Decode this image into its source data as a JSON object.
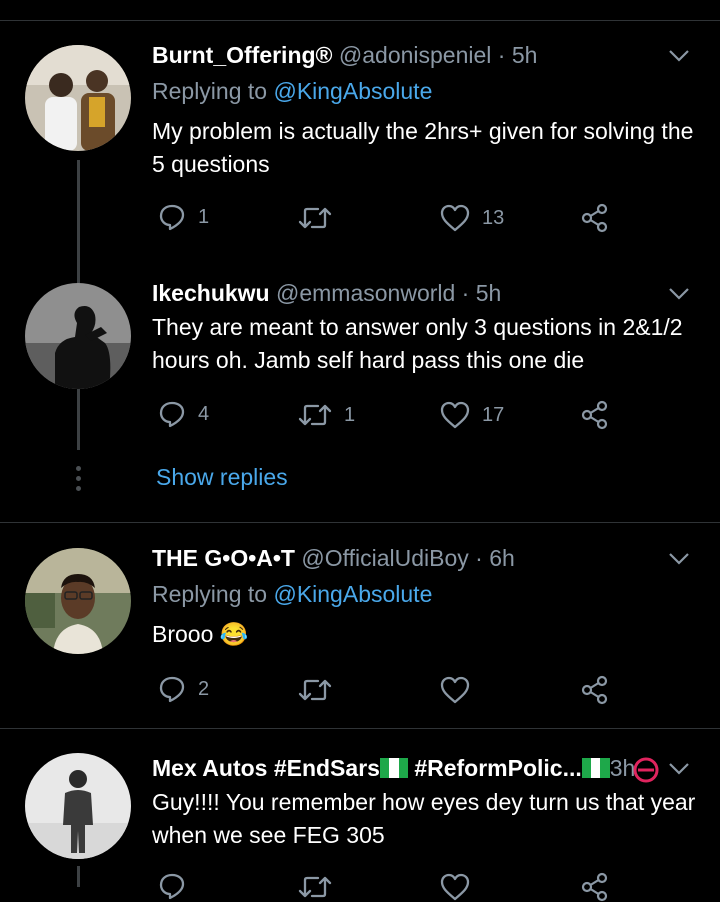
{
  "tweets": [
    {
      "name": "Burnt_Offering®",
      "handle": "@adonispeniel · 5h",
      "replying_prefix": "Replying to ",
      "replying_to": "@KingAbsolute",
      "text": "My problem is actually the 2hrs+ given for solving the 5 questions",
      "replies": "1",
      "retweets": "",
      "likes": "13"
    },
    {
      "name": "Ikechukwu",
      "handle": "@emmasonworld · 5h",
      "text": "They are meant to answer only 3 questions in 2&1/2 hours oh. Jamb self hard pass this one die",
      "replies": "4",
      "retweets": "1",
      "likes": "17"
    },
    {
      "name": "THE G•O•A•T",
      "handle": "@OfficialUdiBoy · 6h",
      "replying_prefix": "Replying to ",
      "replying_to": "@KingAbsolute",
      "text": "Brooo 😂",
      "replies": "2",
      "retweets": "",
      "likes": ""
    },
    {
      "name_part1": "Mex Autos #EndSars",
      "name_part2": "#ReformPolic...",
      "handle": "3h",
      "text": "Guy!!!! You remember how eyes dey turn us that year when we see FEG 305"
    }
  ],
  "show_replies": "Show replies",
  "colors": {
    "background": "#000000",
    "secondary_text": "#8b98a5",
    "link": "#4aa8ea",
    "divider": "#2f3336",
    "flag_green": "#1ea84a"
  },
  "icons": [
    "reply-icon",
    "retweet-icon",
    "like-icon",
    "share-icon",
    "chevron-down-icon"
  ]
}
